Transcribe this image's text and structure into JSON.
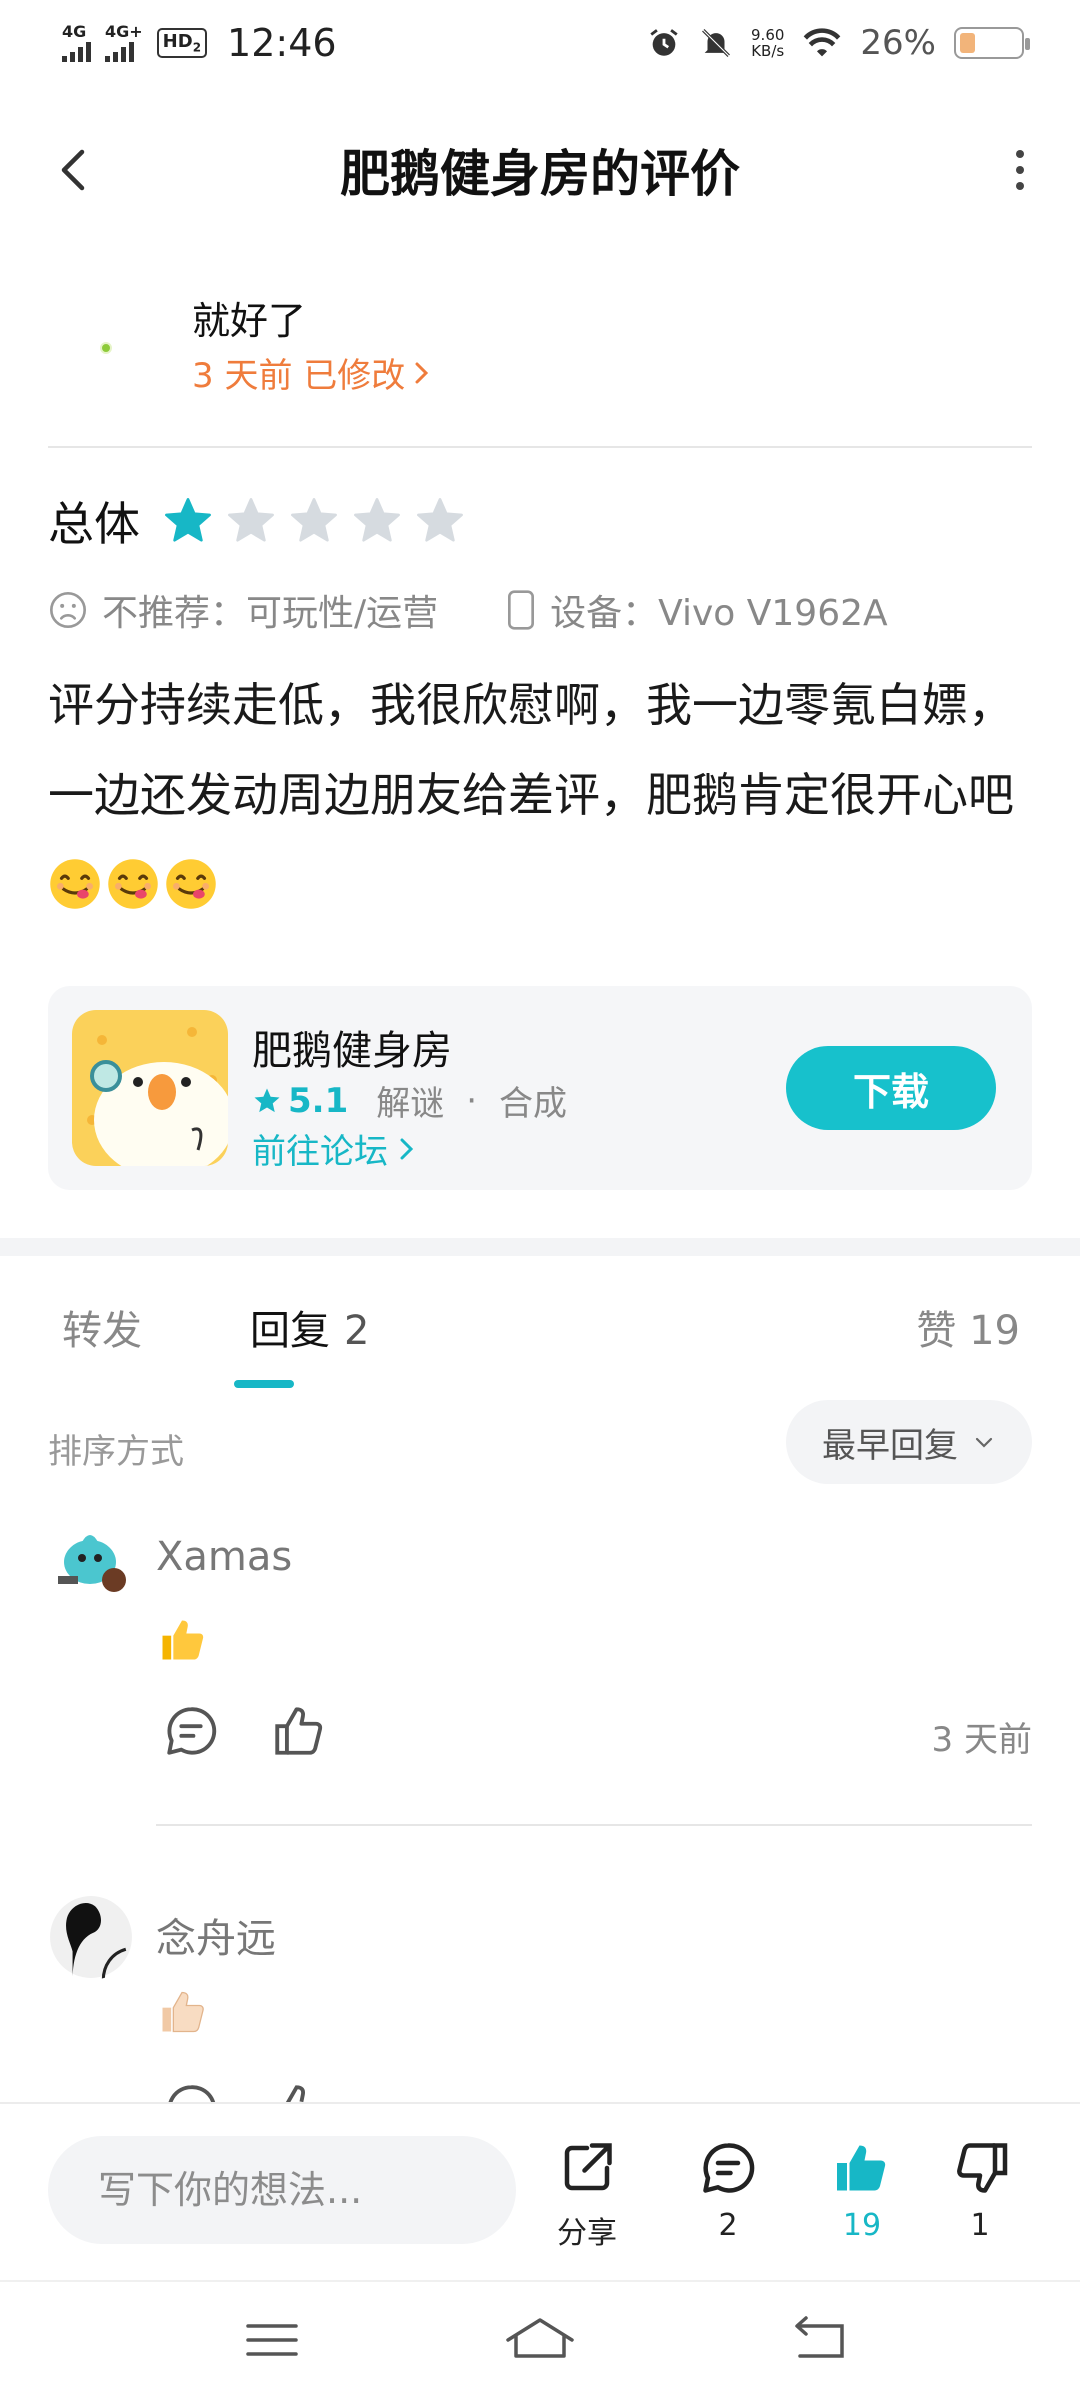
{
  "status_bar": {
    "net1": "4G",
    "net2": "4G+",
    "hd": "HD",
    "hd_sim": "2",
    "time": "12:46",
    "speed_value": "9.60",
    "speed_unit": "KB/s",
    "battery": "26%",
    "battery_level": 0.26
  },
  "header": {
    "title": "肥鹅健身房的评价",
    "back_icon": "chevron-left-icon",
    "more_icon": "more-vertical-icon"
  },
  "review": {
    "author": "就好了",
    "meta": "3 天前 已修改",
    "rating_label": "总体",
    "rating": 1,
    "rating_max": 5,
    "tag_not_recommend": "不推荐：可玩性/运营",
    "tag_device": "设备：Vivo V1962A",
    "body": "评分持续走低，我很欣慰啊，我一边零氪白嫖，一边还发动周边朋友给差评，肥鹅肯定很开心吧",
    "emojis": [
      "yum-emoji",
      "yum-emoji",
      "yum-emoji"
    ]
  },
  "game_card": {
    "name": "肥鹅健身房",
    "score": "5.1",
    "genre1": "解谜",
    "dot": "·",
    "genre2": "合成",
    "forum": "前往论坛",
    "download": "下载"
  },
  "tabs": {
    "repost": "转发",
    "reply": "回复",
    "reply_count": "2",
    "like": "赞 19"
  },
  "sort": {
    "label": "排序方式",
    "value": "最早回复"
  },
  "comments": [
    {
      "name": "Xamas",
      "emoji": "thumbs-up-emoji",
      "time": "3 天前"
    },
    {
      "name": "念舟远",
      "emoji": "thumbs-up-light-emoji"
    }
  ],
  "bottom_bar": {
    "placeholder": "写下你的想法...",
    "share": "分享",
    "comments": "2",
    "likes": "19",
    "dislikes": "1"
  },
  "colors": {
    "accent": "#17b7c6",
    "button": "#17c1cc",
    "meta_orange": "#ef7c3c"
  }
}
